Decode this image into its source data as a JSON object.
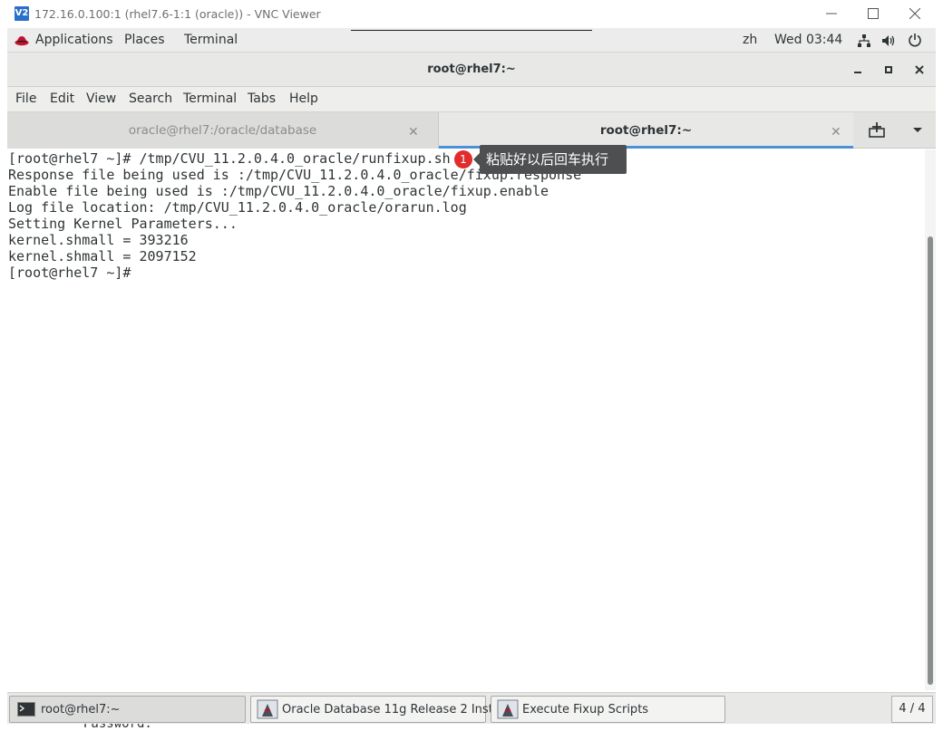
{
  "vnc": {
    "logo": "V2",
    "title": "172.16.0.100:1 (rhel7.6-1:1 (oracle)) - VNC Viewer"
  },
  "gnome_topbar": {
    "applications": "Applications",
    "places": "Places",
    "terminal": "Terminal",
    "language": "zh",
    "clock": "Wed 03:44"
  },
  "terminal_window": {
    "title": "root@rhel7:~",
    "menu": [
      "File",
      "Edit",
      "View",
      "Search",
      "Terminal",
      "Tabs",
      "Help"
    ],
    "tabs": [
      {
        "label": "oracle@rhel7:/oracle/database",
        "active": false
      },
      {
        "label": "root@rhel7:~",
        "active": true
      }
    ],
    "lines": [
      "[root@rhel7 ~]# /tmp/CVU_11.2.0.4.0_oracle/runfixup.sh",
      "Response file being used is :/tmp/CVU_11.2.0.4.0_oracle/fixup.response",
      "Enable file being used is :/tmp/CVU_11.2.0.4.0_oracle/fixup.enable",
      "Log file location: /tmp/CVU_11.2.0.4.0_oracle/orarun.log",
      "Setting Kernel Parameters...",
      "kernel.shmall = 393216",
      "kernel.shmall = 2097152",
      "[root@rhel7 ~]#"
    ]
  },
  "annotation": {
    "number": "1",
    "text": "粘贴好以后回车执行"
  },
  "taskbar": {
    "items": [
      {
        "label": "root@rhel7:~",
        "icon": "terminal-icon"
      },
      {
        "label": "Oracle Database 11g Release 2 Insta...",
        "icon": "oracle-installer-icon"
      },
      {
        "label": "Execute Fixup Scripts",
        "icon": "oracle-installer-icon"
      }
    ],
    "workspace": "4 / 4"
  },
  "background_text": "Password:",
  "colors": {
    "annotation_badge": "#e02c2c",
    "callout_bg": "#4d4f51",
    "active_tab_underline": "#4a90d9",
    "vnc_logo": "#2a6fc9"
  }
}
